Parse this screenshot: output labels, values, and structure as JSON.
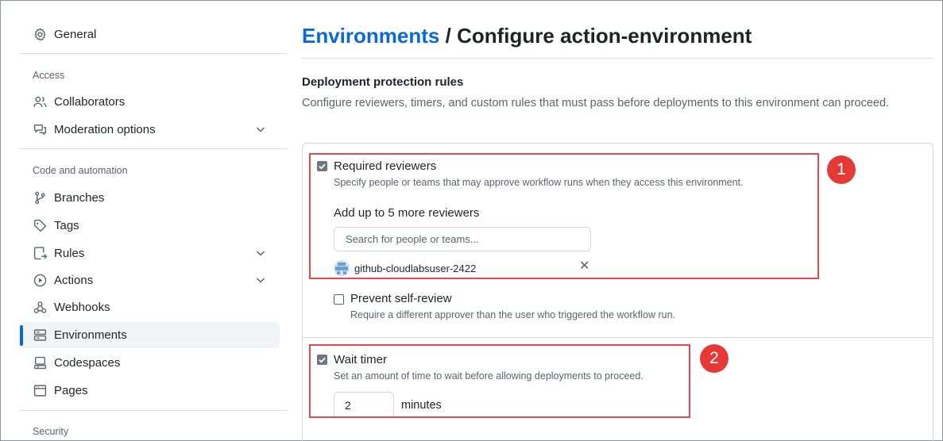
{
  "sidebar": {
    "general": "General",
    "access_label": "Access",
    "collaborators": "Collaborators",
    "moderation": "Moderation options",
    "code_label": "Code and automation",
    "branches": "Branches",
    "tags": "Tags",
    "rules": "Rules",
    "actions": "Actions",
    "webhooks": "Webhooks",
    "environments": "Environments",
    "codespaces": "Codespaces",
    "pages": "Pages",
    "security_label": "Security",
    "active_item": "Environments"
  },
  "header": {
    "breadcrumb_link": "Environments",
    "separator": "/",
    "title": "Configure action-environment"
  },
  "protection": {
    "heading": "Deployment protection rules",
    "description": "Configure reviewers, timers, and custom rules that must pass before deployments to this environment can proceed.",
    "required_reviewers": {
      "label": "Required reviewers",
      "checked": true,
      "help": "Specify people or teams that may approve workflow runs when they access this environment.",
      "add_label": "Add up to 5 more reviewers",
      "search_placeholder": "Search for people or teams...",
      "reviewer": "github-cloudlabsuser-2422",
      "remove_glyph": "✕"
    },
    "prevent_self_review": {
      "label": "Prevent self-review",
      "checked": false,
      "help": "Require a different approver than the user who triggered the workflow run."
    },
    "wait_timer": {
      "label": "Wait timer",
      "checked": true,
      "help": "Set an amount of time to wait before allowing deployments to proceed.",
      "value": "2",
      "unit": "minutes"
    }
  },
  "annotations": {
    "badge1": "1",
    "badge2": "2",
    "color": "#e24a4f"
  },
  "colors": {
    "link": "#0969da",
    "accent_bar": "#0969da",
    "annotation": "#e53935"
  }
}
